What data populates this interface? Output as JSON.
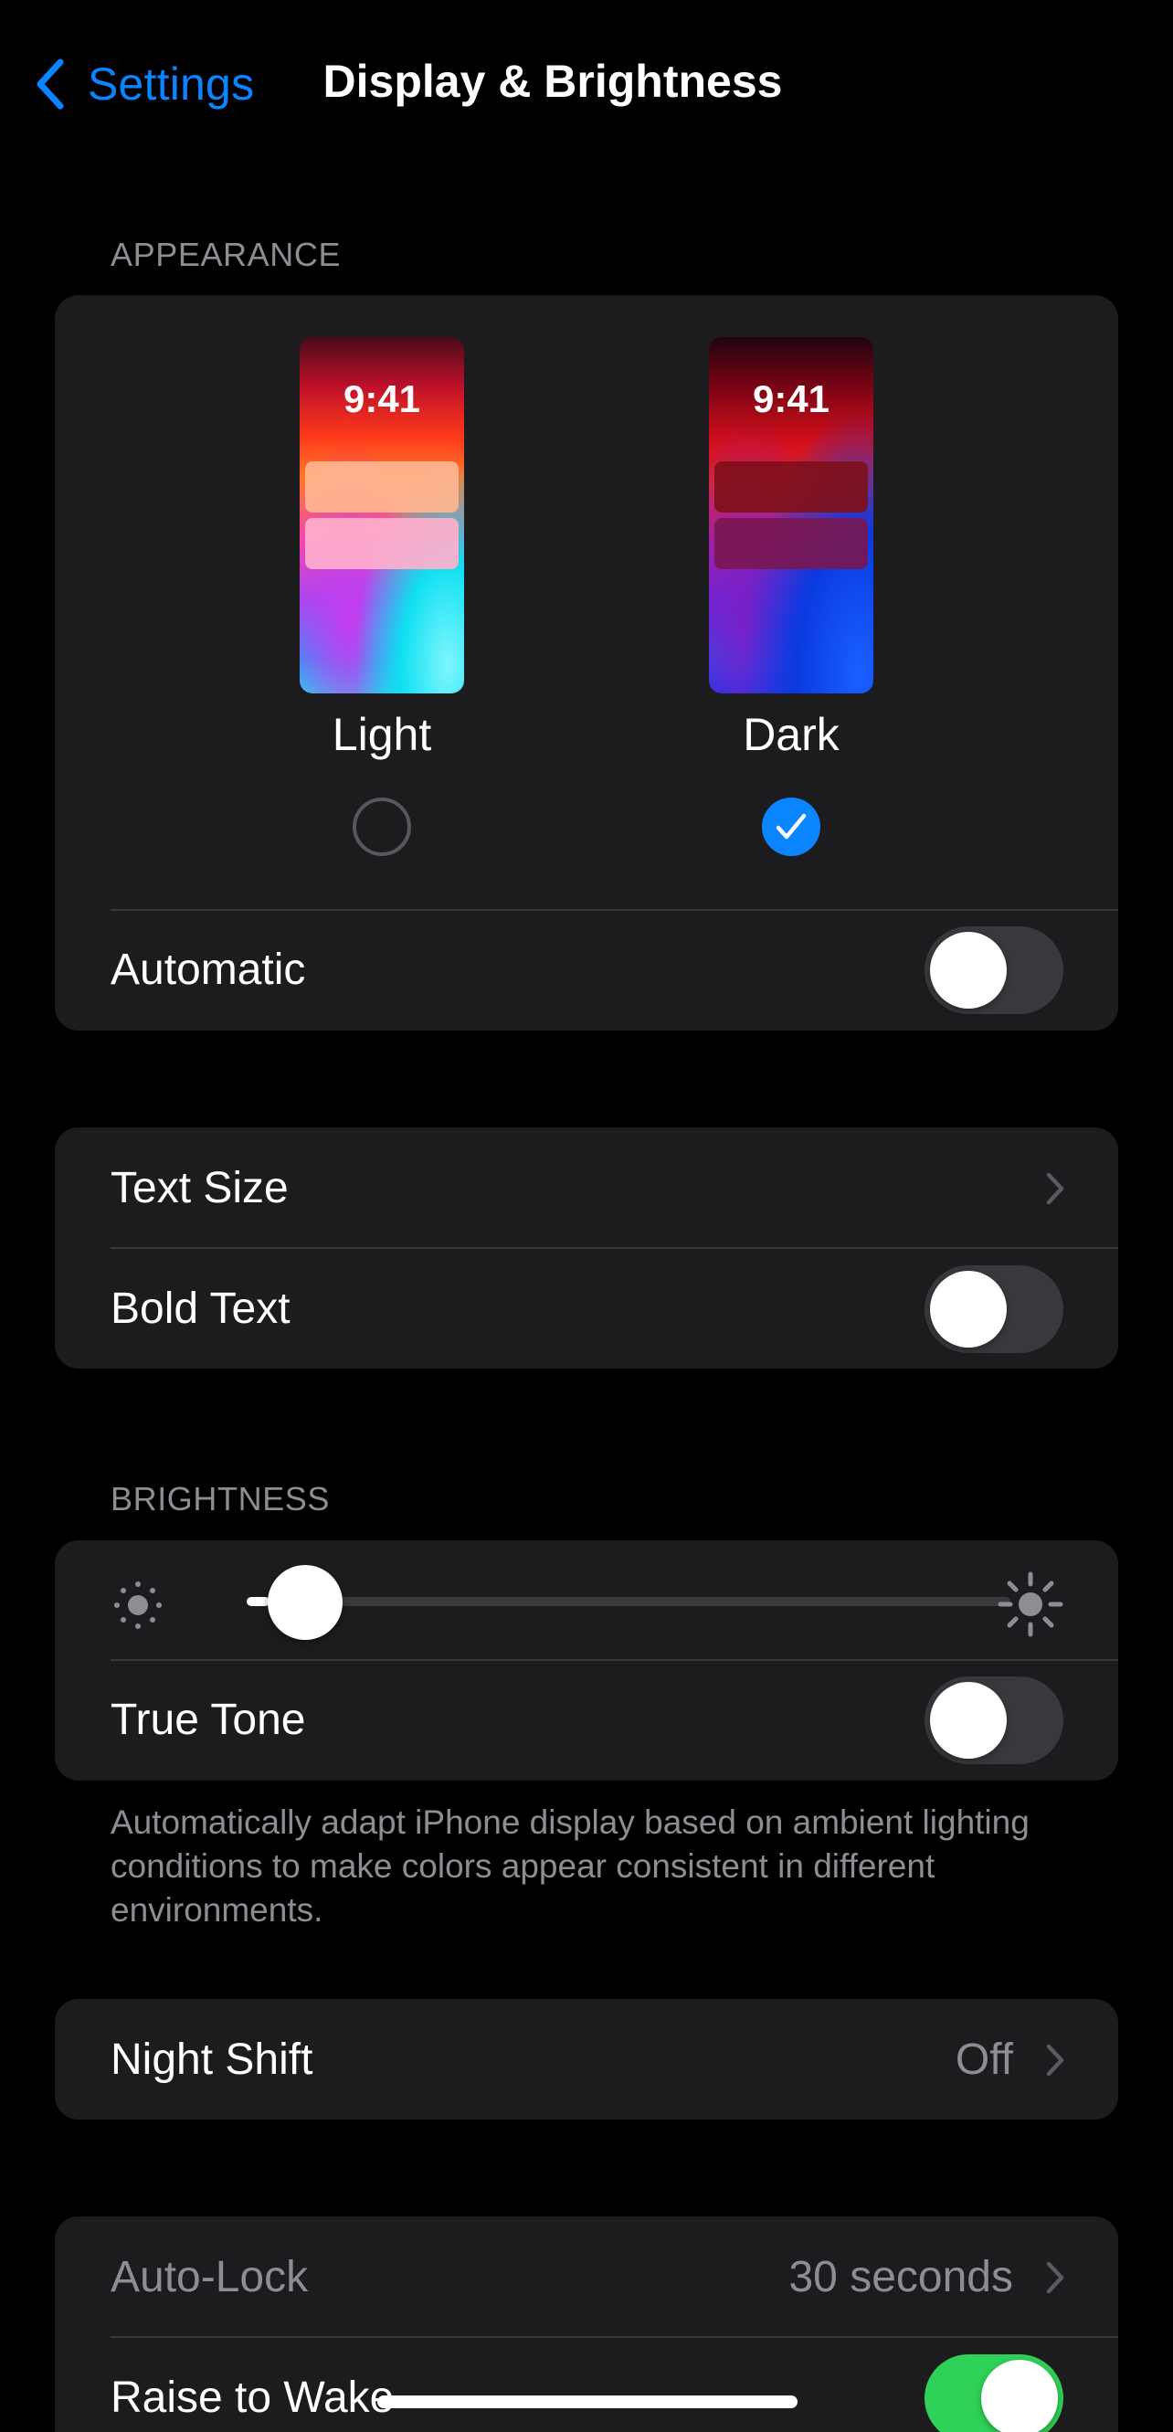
{
  "nav": {
    "back_label": "Settings",
    "title": "Display & Brightness"
  },
  "appearance": {
    "header": "APPEARANCE",
    "light": {
      "time": "9:41",
      "label": "Light",
      "selected": false
    },
    "dark": {
      "time": "9:41",
      "label": "Dark",
      "selected": true
    },
    "automatic": {
      "label": "Automatic",
      "on": false
    }
  },
  "text_group": {
    "text_size": {
      "label": "Text Size"
    },
    "bold_text": {
      "label": "Bold Text",
      "on": false
    }
  },
  "brightness": {
    "header": "BRIGHTNESS",
    "level_fraction": 0.03,
    "min_icon": "sun-min-icon",
    "max_icon": "sun-max-icon",
    "true_tone": {
      "label": "True Tone",
      "on": false
    },
    "footer": "Automatically adapt iPhone display based on ambient lighting conditions to make colors appear consistent in different environments."
  },
  "night_shift": {
    "label": "Night Shift",
    "value": "Off"
  },
  "lock_group": {
    "auto_lock": {
      "label": "Auto-Lock",
      "value": "30 seconds"
    },
    "raise_to_wake": {
      "label": "Raise to Wake",
      "on": true
    }
  },
  "colors": {
    "accent": "#0a84ff",
    "toggle_on": "#30d158",
    "group_bg": "#1c1c1e",
    "secondary_text": "#8d8d93"
  }
}
